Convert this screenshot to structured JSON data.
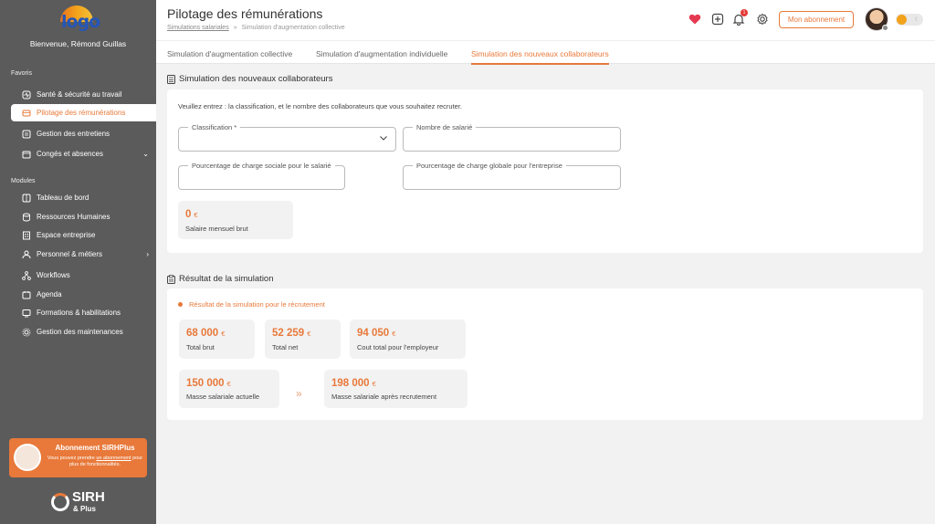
{
  "sidebar": {
    "logo_text": "logo",
    "welcome": "Bienvenue, Rémond Guillas",
    "favoris_label": "Favoris",
    "favoris": [
      {
        "label": "Santé & sécurité au travail",
        "icon": "health-icon"
      },
      {
        "label": "Pilotage des rémunérations",
        "icon": "pay-icon",
        "active": true
      },
      {
        "label": "Gestion des entretiens",
        "icon": "interview-icon"
      },
      {
        "label": "Congés et absences",
        "icon": "calendar-icon",
        "chevron": "⌄"
      }
    ],
    "modules_label": "Modules",
    "modules": [
      {
        "label": "Tableau de bord",
        "icon": "dashboard-icon"
      },
      {
        "label": "Ressources Humaines",
        "icon": "hr-icon"
      },
      {
        "label": "Espace entreprise",
        "icon": "building-icon"
      },
      {
        "label": "Personnel & métiers",
        "icon": "staff-icon",
        "chevron": "›"
      },
      {
        "label": "Workflows",
        "icon": "workflow-icon"
      },
      {
        "label": "Agenda",
        "icon": "agenda-icon"
      },
      {
        "label": "Formations & habilitations",
        "icon": "training-icon"
      },
      {
        "label": "Gestion des maintenances",
        "icon": "maintenance-icon"
      }
    ],
    "promo": {
      "title": "Abonnement SIRHPlus",
      "text_before": "Vous pouvez prendre ",
      "link": "un abonnement",
      "text_after": " pour plus de fonctionnalités."
    },
    "brand": {
      "name": "SIRH",
      "sub": "& Plus"
    }
  },
  "header": {
    "title": "Pilotage des rémunérations",
    "breadcrumb": {
      "link": "Simulations salariales",
      "sep": "»",
      "current": "Simulation d'augmentation collective"
    },
    "notif_count": "1",
    "subscription_button": "Mon abonnement"
  },
  "tabs": [
    {
      "label": "Simulation d'augmentation collective",
      "active": false
    },
    {
      "label": "Simulation d'augmentation individuelle",
      "active": false
    },
    {
      "label": "Simulation des nouveaux collaborateurs",
      "active": true
    }
  ],
  "simulation": {
    "section_title": "Simulation des nouveaux collaborateurs",
    "instructions": "Veuillez entrez : la classification, et le nombre des collaborateurs que vous souhaitez recruter.",
    "fields": {
      "classification": "Classification *",
      "nombre": "Nombre de salarié",
      "charge_salarie": "Pourcentage de charge sociale pour le salarié",
      "charge_entreprise": "Pourcentage de charge globale pour l'entreprise"
    },
    "salaire": {
      "value": "0",
      "currency": "€",
      "label": "Salaire mensuel brut"
    }
  },
  "result": {
    "section_title": "Résultat de la simulation",
    "subtitle": "Résultat de la simulation pour le récrutement",
    "cards": [
      {
        "value": "68 000",
        "currency": "€",
        "label": "Total brut"
      },
      {
        "value": "52 259",
        "currency": "€",
        "label": "Total net"
      },
      {
        "value": "94 050",
        "currency": "€",
        "label": "Cout total pour l'employeur"
      }
    ],
    "masse_actuelle": {
      "value": "150 000",
      "currency": "€",
      "label": "Masse salariale actuelle"
    },
    "masse_apres": {
      "value": "198 000",
      "currency": "€",
      "label": "Masse salariale après recrutement"
    },
    "arrow": "»"
  },
  "colors": {
    "accent": "#e8793a",
    "sidebar": "#5b5b5b",
    "background": "#f2f2f2"
  }
}
